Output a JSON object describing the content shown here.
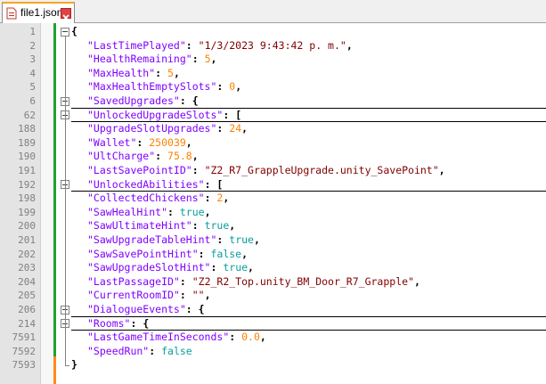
{
  "tab": {
    "filename": "file1.json",
    "file_icon": "document-icon",
    "close_icon": "close-icon"
  },
  "lines": [
    {
      "num": "1",
      "key": null,
      "brace": "{"
    },
    {
      "num": "2",
      "key": "\"LastTimePlayed\"",
      "val": "\"1/3/2023 9:43:42 p. m.\"",
      "vt": "s",
      "tail": ","
    },
    {
      "num": "3",
      "key": "\"HealthRemaining\"",
      "val": "5",
      "vt": "n",
      "tail": ","
    },
    {
      "num": "4",
      "key": "\"MaxHealth\"",
      "val": "5",
      "vt": "n",
      "tail": ","
    },
    {
      "num": "5",
      "key": "\"MaxHealthEmptySlots\"",
      "val": "0",
      "vt": "n",
      "tail": ","
    },
    {
      "num": "6",
      "key": "\"SavedUpgrades\"",
      "val": "{",
      "vt": "p",
      "tail": "",
      "folded": true
    },
    {
      "num": "62",
      "key": "\"UnlockedUpgradeSlots\"",
      "val": "[",
      "vt": "p",
      "tail": "",
      "folded": true
    },
    {
      "num": "188",
      "key": "\"UpgradeSlotUpgrades\"",
      "val": "24",
      "vt": "n",
      "tail": ","
    },
    {
      "num": "189",
      "key": "\"Wallet\"",
      "val": "250039",
      "vt": "n",
      "tail": ","
    },
    {
      "num": "190",
      "key": "\"UltCharge\"",
      "val": "75.8",
      "vt": "n",
      "tail": ","
    },
    {
      "num": "191",
      "key": "\"LastSavePointID\"",
      "val": "\"Z2_R7_GrappleUpgrade.unity_SavePoint\"",
      "vt": "s",
      "tail": ","
    },
    {
      "num": "192",
      "key": "\"UnlockedAbilities\"",
      "val": "[",
      "vt": "p",
      "tail": "",
      "folded": true
    },
    {
      "num": "198",
      "key": "\"CollectedChickens\"",
      "val": "2",
      "vt": "n",
      "tail": ","
    },
    {
      "num": "199",
      "key": "\"SawHealHint\"",
      "val": "true",
      "vt": "b",
      "tail": ","
    },
    {
      "num": "200",
      "key": "\"SawUltimateHint\"",
      "val": "true",
      "vt": "b",
      "tail": ","
    },
    {
      "num": "201",
      "key": "\"SawUpgradeTableHint\"",
      "val": "true",
      "vt": "b",
      "tail": ","
    },
    {
      "num": "202",
      "key": "\"SawSavePointHint\"",
      "val": "false",
      "vt": "b",
      "tail": ","
    },
    {
      "num": "203",
      "key": "\"SawUpgradeSlotHint\"",
      "val": "true",
      "vt": "b",
      "tail": ","
    },
    {
      "num": "204",
      "key": "\"LastPassageID\"",
      "val": "\"Z2_R2_Top.unity_BM_Door_R7_Grapple\"",
      "vt": "s",
      "tail": ","
    },
    {
      "num": "205",
      "key": "\"CurrentRoomID\"",
      "val": "\"\"",
      "vt": "s",
      "tail": ","
    },
    {
      "num": "206",
      "key": "\"DialogueEvents\"",
      "val": "{",
      "vt": "p",
      "tail": "",
      "folded": true
    },
    {
      "num": "214",
      "key": "\"Rooms\"",
      "val": "{",
      "vt": "p",
      "tail": "",
      "folded": true
    },
    {
      "num": "7591",
      "key": "\"LastGameTimeInSeconds\"",
      "val": "0.0",
      "vt": "n",
      "tail": ","
    },
    {
      "num": "7592",
      "key": "\"SpeedRun\"",
      "val": "false",
      "vt": "b",
      "tail": ""
    },
    {
      "num": "7593",
      "key": null,
      "brace": "}"
    }
  ],
  "colors": {
    "key": "#8000ff",
    "string": "#800000",
    "number": "#ff8000",
    "boolean": "#0a9d9d",
    "change_bar": "#21a031",
    "tab_accent": "#f5a623"
  }
}
